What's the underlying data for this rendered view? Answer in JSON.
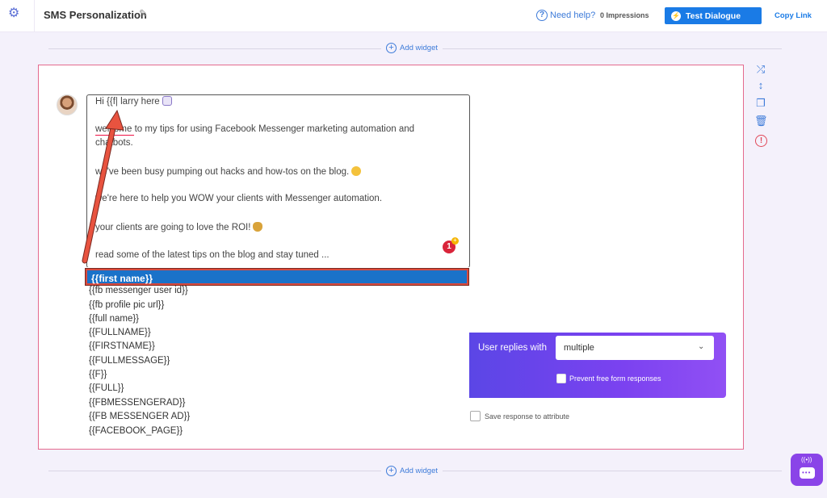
{
  "header": {
    "title": "SMS Personalization",
    "help": "Need help?",
    "impressions": "0 Impressions",
    "test_button": "Test Dialogue",
    "copy_link": "Copy Link"
  },
  "add_widget": "Add widget",
  "editor": {
    "lines": [
      "Hi {{f| larry here",
      "welcome to my tips for using Facebook Messenger marketing automation and",
      "chatbots.",
      "we've been busy pumping out hacks and how-tos on the blog.",
      "we're here to help you WOW your clients with Messenger automation.",
      "your clients are going to love the ROI!",
      "read some of the latest tips on the blog and stay tuned ..."
    ],
    "badge": "1"
  },
  "dropdown": {
    "selected": "{{first name}}",
    "items": [
      "{{fb messenger user id}}",
      "{{fb profile pic url}}",
      "{{full name}}",
      "{{FULLNAME}}",
      "{{FIRSTNAME}}",
      "{{FULLMESSAGE}}",
      "{{F}}",
      "{{FULL}}",
      "{{FBMESSENGERAD}}",
      "{{FB MESSENGER AD}}",
      "{{FACEBOOK_PAGE}}"
    ]
  },
  "replies": {
    "label": "User replies with",
    "value": "multiple",
    "prevent": "Prevent free form responses"
  },
  "save_response": "Save response to attribute",
  "icons": {
    "settings": "gear-icon",
    "edit": "pencil-icon",
    "shuffle": "shuffle-icon",
    "move": "move-vertical-icon",
    "copy": "copy-icon",
    "delete": "trash-icon",
    "warning": "warning-icon",
    "chat": "chat-widget-icon"
  },
  "colors": {
    "accent": "#1a7be6",
    "card_border": "#e46a8e",
    "panel_gradient_start": "#5b46e6",
    "panel_gradient_end": "#9150f4",
    "highlight_border": "#d94a3e"
  }
}
